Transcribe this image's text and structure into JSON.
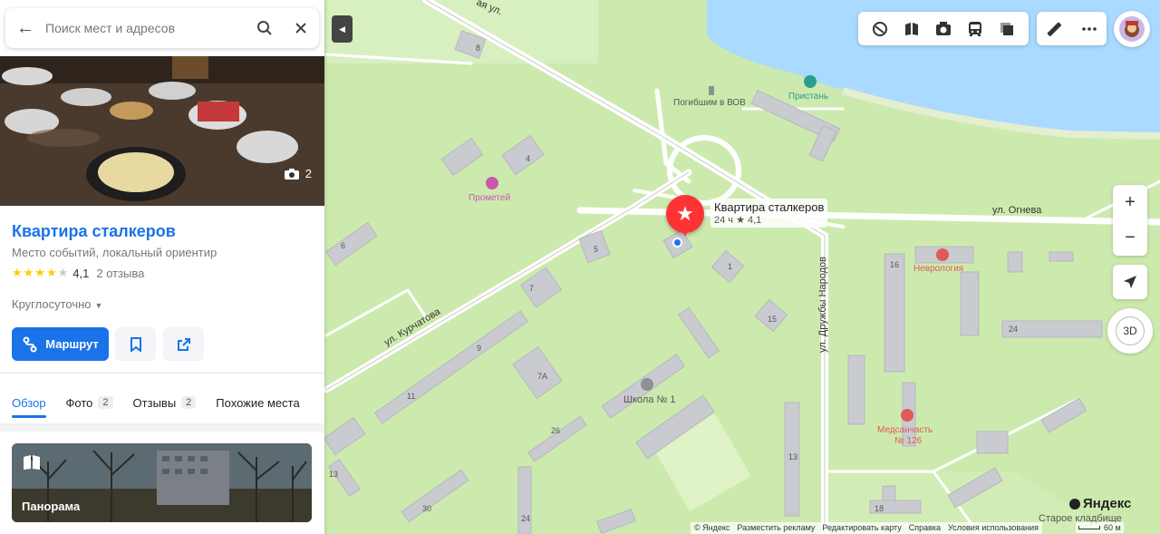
{
  "search": {
    "placeholder": "Поиск мест и адресов",
    "value": ""
  },
  "place": {
    "name": "Квартира сталкеров",
    "category": "Место событий, локальный ориентир",
    "rating": "4,1",
    "rating_stars": 4,
    "reviews": "2 отзыва",
    "hours": "Круглосуточно",
    "photo_count": "2"
  },
  "actions": {
    "route_label": "Маршрут"
  },
  "tabs": [
    {
      "label": "Обзор",
      "badge": ""
    },
    {
      "label": "Фото",
      "badge": "2"
    },
    {
      "label": "Отзывы",
      "badge": "2"
    },
    {
      "label": "Похожие места",
      "badge": ""
    }
  ],
  "panorama": {
    "label": "Панорама"
  },
  "marker": {
    "name": "Квартира сталкеров",
    "hours": "24 ч",
    "rating": "★ 4,1"
  },
  "map_labels": {
    "monument": "Погибшим в ВОВ",
    "pier": "Пристань",
    "prometheus": "Прометей",
    "neurology": "Неврология",
    "medsanchast_1": "Медсанчасть",
    "medsanchast_2": "№ 126",
    "school": "Школа № 1",
    "cemetery": "Старое кладбище",
    "street_ogneva": "ул. Огнева",
    "street_kurchatova": "ул. Курчатова",
    "street_druzhby": "ул. Дружбы Народов",
    "street_top": "ая ул.",
    "house_8": "8",
    "house_4": "4",
    "house_6": "6",
    "house_5": "5",
    "house_7": "7",
    "house_1": "1",
    "house_15": "15",
    "house_16": "16",
    "house_24a": "24",
    "house_9": "9",
    "house_11": "11",
    "house_7a": "7А",
    "house_26": "26",
    "house_13a": "13",
    "house_13b": "13",
    "house_30": "30",
    "house_24b": "24",
    "house_18": "18"
  },
  "controls": {
    "zoom_in": "+",
    "zoom_out": "−",
    "btn_3d": "3D"
  },
  "footer": {
    "copyright": "© Яндекс",
    "ads": "Разместить рекламу",
    "edit": "Редактировать карту",
    "help": "Справка",
    "terms": "Условия использования",
    "logo": "Яндекс",
    "scale": "60 м"
  },
  "colors": {
    "accent": "#1a73e8",
    "marker": "#ff3333",
    "water": "#aadaff",
    "park": "#cdeaae"
  }
}
